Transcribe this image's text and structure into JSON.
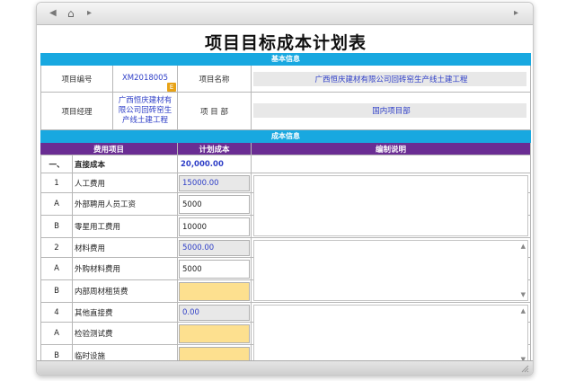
{
  "toolbar": {
    "back_icon": "◀",
    "home_icon": "⌂",
    "fwd_icon": "▸",
    "right_icon": "▸"
  },
  "title": "项目目标成本计划表",
  "basic": {
    "band": "基本信息",
    "project_no_label": "项目编号",
    "project_no_value": "XM2018005",
    "project_name_label": "项目名称",
    "project_name_value": "广西恒庆建材有限公司回砖窑生产线土建工程",
    "manager_label": "项目经理",
    "manager_value": "广西恒庆建材有限公司回砖窑生产线土建工程",
    "dept_label": "项 目 部",
    "dept_value": "国内项目部",
    "badge": "E"
  },
  "cost": {
    "band": "成本信息",
    "headers": [
      "费用项目",
      "计划成本",
      "编制说明"
    ],
    "rows": [
      {
        "no": "一、",
        "name": "直接成本",
        "value": "20,000.00",
        "kind": "total"
      },
      {
        "no": "1",
        "name": "人工费用",
        "value": "15000.00",
        "kind": "sub"
      },
      {
        "no": "A",
        "name": "外部聘用人员工资",
        "value": "5000",
        "kind": "input"
      },
      {
        "no": "B",
        "name": "零星用工费用",
        "value": "10000",
        "kind": "input"
      },
      {
        "no": "2",
        "name": "材料费用",
        "value": "5000.00",
        "kind": "sub"
      },
      {
        "no": "A",
        "name": "外购材料费用",
        "value": "5000",
        "kind": "input"
      },
      {
        "no": "B",
        "name": "内部周材租赁费",
        "value": "",
        "kind": "yellow"
      },
      {
        "no": "4",
        "name": "其他直接费",
        "value": "0.00",
        "kind": "sub"
      },
      {
        "no": "A",
        "name": "检验测试费",
        "value": "",
        "kind": "yellow"
      },
      {
        "no": "B",
        "name": "临时设施",
        "value": "",
        "kind": "yellow"
      }
    ]
  }
}
